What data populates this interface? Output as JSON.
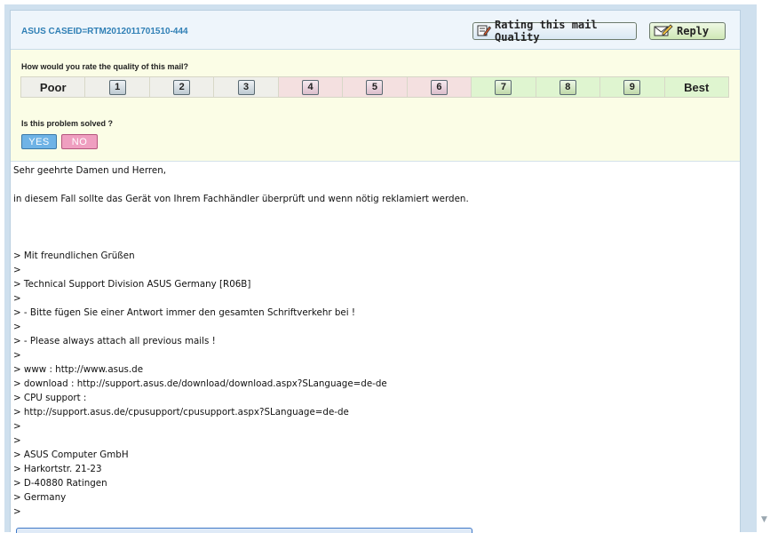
{
  "header": {
    "case_id": "ASUS CASEID=RTM2012011701510-444",
    "rating_button": "Rating this mail Quality",
    "reply_button": "Reply"
  },
  "rating": {
    "question": "How would you rate the quality of this mail?",
    "poor_label": "Poor",
    "best_label": "Best",
    "numbers": [
      "1",
      "2",
      "3",
      "4",
      "5",
      "6",
      "7",
      "8",
      "9"
    ]
  },
  "solved": {
    "question": "Is this problem solved ?",
    "yes": "YES",
    "no": "NO"
  },
  "mail": {
    "lines": [
      "Sehr geehrte Damen und Herren,",
      "",
      "in diesem Fall sollte das Gerät von Ihrem Fachhändler überprüft und wenn nötig reklamiert werden.",
      "",
      "",
      "",
      "> Mit freundlichen Grüßen",
      ">",
      "> Technical Support Division ASUS Germany [R06B]",
      ">",
      "> - Bitte fügen Sie einer Antwort immer den gesamten Schriftverkehr bei !",
      ">",
      "> - Please always attach all previous mails !",
      ">",
      "> www : http://www.asus.de",
      "> download : http://support.asus.de/download/download.aspx?SLanguage=de-de",
      "> CPU support :",
      "> http://support.asus.de/cpusupport/cpusupport.aspx?SLanguage=de-de",
      ">",
      ">",
      "> ASUS Computer GmbH",
      "> Harkortstr. 21-23",
      "> D-40880 Ratingen",
      "> Germany",
      ">"
    ]
  },
  "icons": {
    "rating_icon": "pencil-note-icon",
    "reply_icon": "pencil-envelope-icon",
    "scroll_down": "scroll-down-arrow-icon"
  },
  "colors": {
    "case_id": "#2f7fb5",
    "yes_button": "#6fb3e6",
    "no_button": "#ef9fc0",
    "rating_bg": "#fbfde6"
  }
}
